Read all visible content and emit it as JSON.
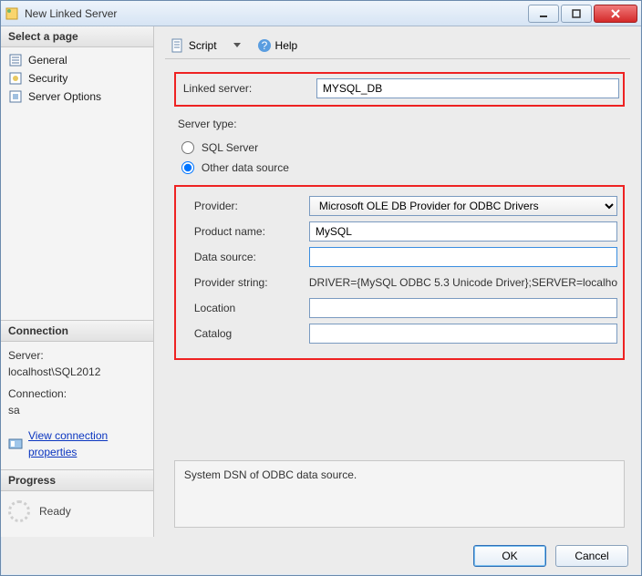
{
  "window": {
    "title": "New Linked Server"
  },
  "toolbar": {
    "script": "Script",
    "help": "Help"
  },
  "left_panel": {
    "select_page": "Select a page",
    "pages": {
      "general": "General",
      "security": "Security",
      "server_options": "Server Options"
    },
    "connection": {
      "header": "Connection",
      "server_label": "Server:",
      "server_value": "localhost\\SQL2012",
      "conn_label": "Connection:",
      "conn_value": "sa",
      "view_props": "View connection properties"
    },
    "progress": {
      "header": "Progress",
      "status": "Ready"
    }
  },
  "form": {
    "linked_server_label": "Linked server:",
    "linked_server_value": "MYSQL_DB",
    "server_type_label": "Server type:",
    "radio_sql": "SQL Server",
    "radio_other": "Other data source",
    "provider_label": "Provider:",
    "provider_value": "Microsoft OLE DB Provider for ODBC Drivers",
    "product_name_label": "Product name:",
    "product_name_value": "MySQL",
    "data_source_label": "Data source:",
    "data_source_value": "",
    "provider_string_label": "Provider string:",
    "provider_string_value": "DRIVER={MySQL ODBC 5.3 Unicode Driver};SERVER=localho",
    "location_label": "Location",
    "location_value": "",
    "catalog_label": "Catalog",
    "catalog_value": ""
  },
  "description": "System DSN of ODBC data source.",
  "buttons": {
    "ok": "OK",
    "cancel": "Cancel"
  }
}
